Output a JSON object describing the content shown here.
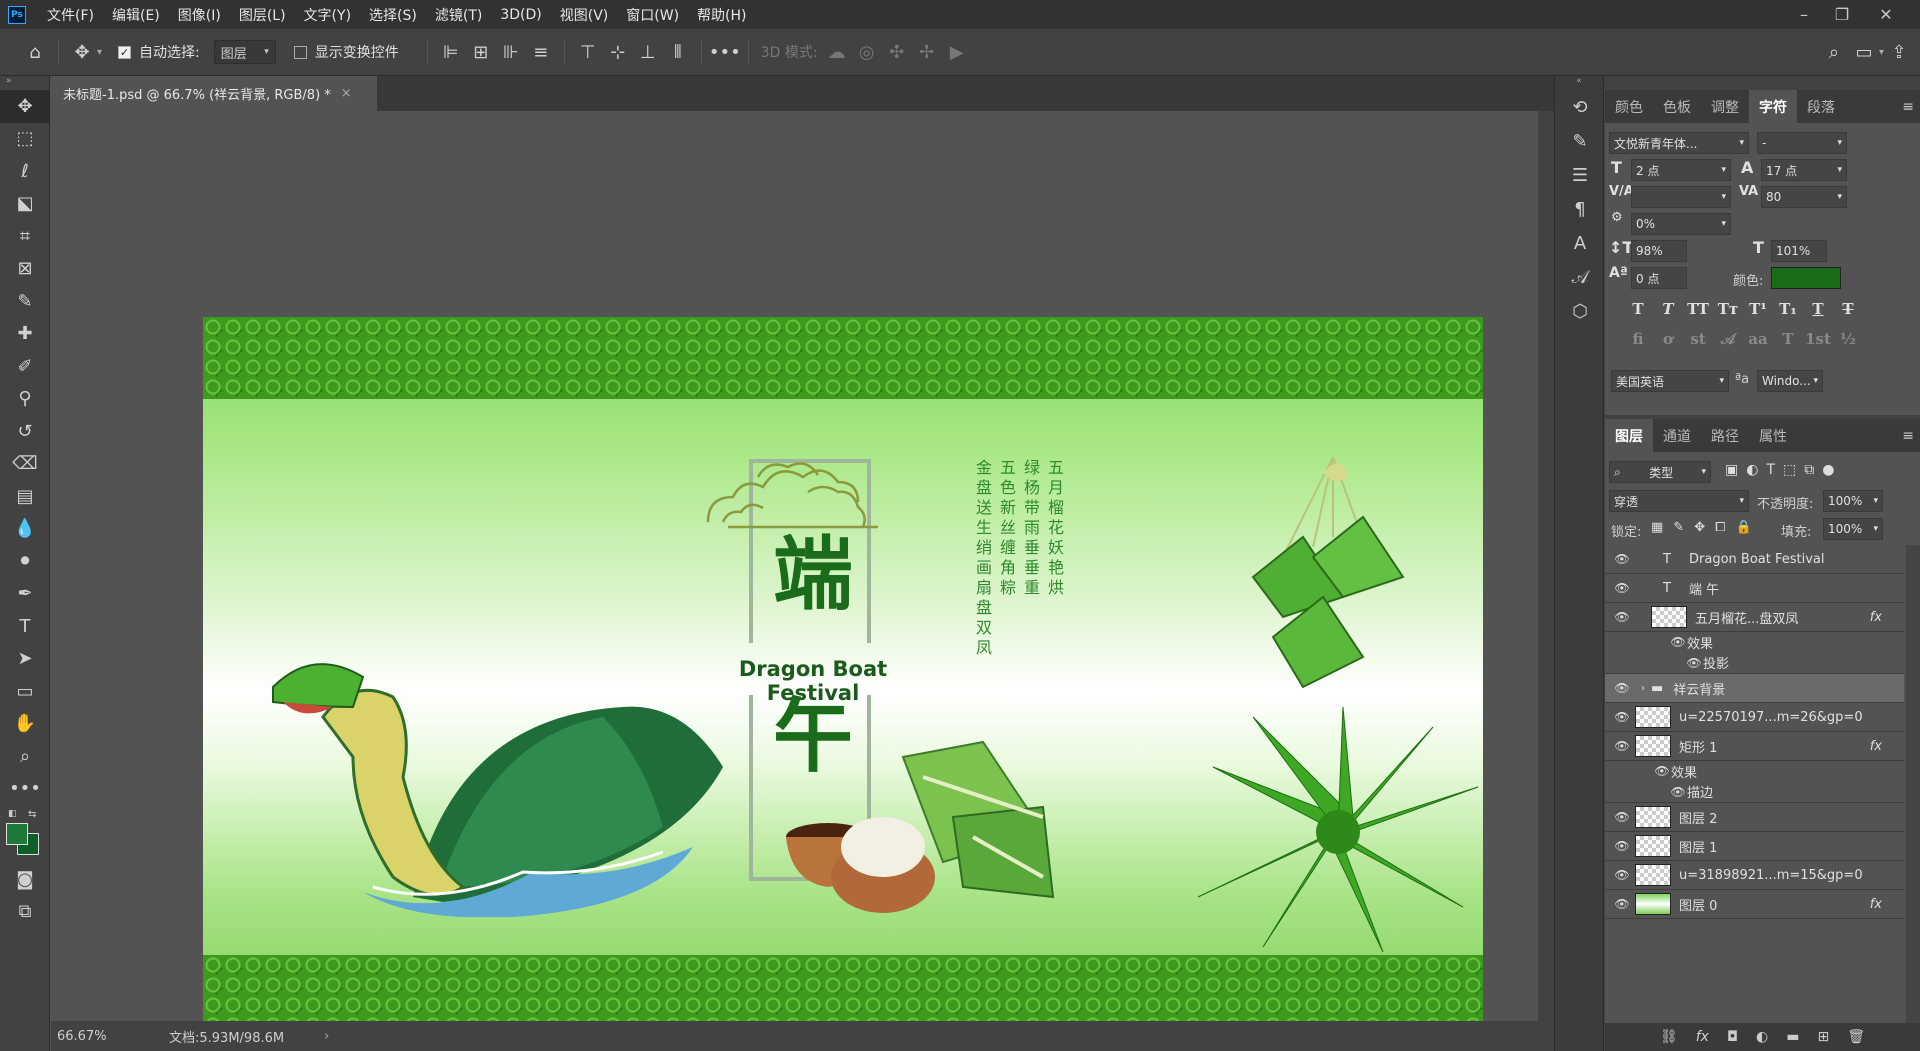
{
  "menubar": {
    "items": [
      "文件(F)",
      "编辑(E)",
      "图像(I)",
      "图层(L)",
      "文字(Y)",
      "选择(S)",
      "滤镜(T)",
      "3D(D)",
      "视图(V)",
      "窗口(W)",
      "帮助(H)"
    ],
    "logo": "Ps"
  },
  "options": {
    "auto_select_label": "自动选择:",
    "layer_select_value": "图层",
    "show_transform_label": "显示变换控件",
    "mode_3d_label": "3D 模式:"
  },
  "document": {
    "tab_title": "未标题-1.psd @ 66.7% (祥云背景, RGB/8) *",
    "title_char_1": "端",
    "title_char_2": "午",
    "subtitle": "Dragon Boat Festival",
    "poem_columns": [
      "五月榴花妖艳烘",
      "绿杨带雨垂垂重",
      "五色新丝缠角粽",
      "金盘送生绡画扇盘双凤"
    ]
  },
  "status": {
    "zoom": "66.67%",
    "doc_size": "文档:5.93M/98.6M"
  },
  "character_panel": {
    "tabs": [
      "颜色",
      "色板",
      "调整",
      "字符",
      "段落"
    ],
    "active_tab": "字符",
    "font_family": "文悦新青年体...",
    "font_style": "-",
    "font_size": "2 点",
    "leading": "17 点",
    "kerning": "",
    "tracking": "80",
    "tsume": "0%",
    "vertical_scale": "98%",
    "horizontal_scale": "101%",
    "baseline_shift": "0 点",
    "color_label": "颜色:",
    "color_value": "#1a6b1a",
    "language": "美国英语",
    "antialias": "Windo..."
  },
  "layers_panel": {
    "tabs": [
      "图层",
      "通道",
      "路径",
      "属性"
    ],
    "active_tab": "图层",
    "filter_kind": "类型",
    "blend_mode": "穿透",
    "opacity_label": "不透明度:",
    "opacity_value": "100%",
    "lock_label": "锁定:",
    "fill_label": "填充:",
    "fill_value": "100%",
    "layers": [
      {
        "name": "Dragon Boat Festival",
        "type": "text"
      },
      {
        "name": "端 午",
        "type": "text"
      },
      {
        "name": "五月榴花...盘双凤",
        "type": "smart",
        "fx": "fx"
      },
      {
        "name": "效果",
        "type": "effect-group"
      },
      {
        "name": "投影",
        "type": "effect"
      },
      {
        "name": "祥云背景",
        "type": "group"
      },
      {
        "name": "u=22570197...m=26&gp=0",
        "type": "image"
      },
      {
        "name": "矩形 1",
        "type": "shape",
        "fx": "fx"
      },
      {
        "name": "效果",
        "type": "effect-group"
      },
      {
        "name": "描边",
        "type": "effect"
      },
      {
        "name": "图层 2",
        "type": "image"
      },
      {
        "name": "图层 1",
        "type": "image"
      },
      {
        "name": "u=31898921...m=15&gp=0",
        "type": "image"
      },
      {
        "name": "图层 0",
        "type": "image",
        "fx": "fx"
      }
    ]
  },
  "colors": {
    "accent_green": "#1a6b1a",
    "foreground_swatch": "#1f7a3a",
    "background_swatch": "#0e5e2a"
  }
}
